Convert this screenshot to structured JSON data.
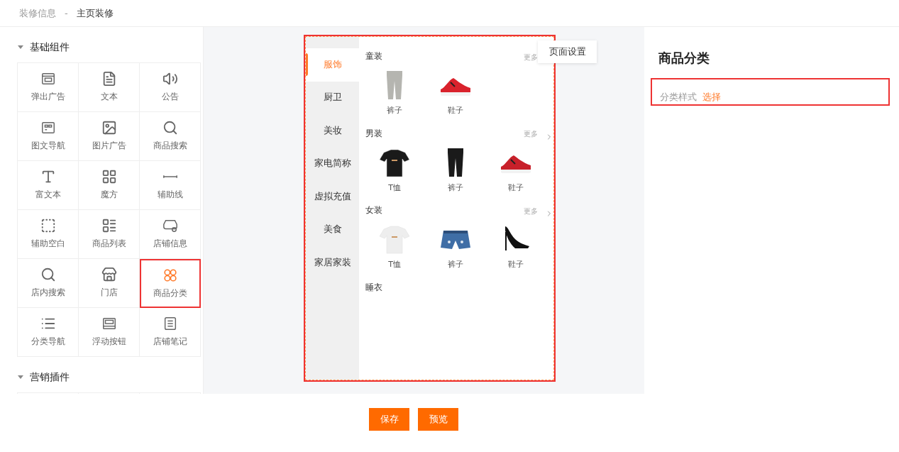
{
  "breadcrumb": {
    "parent": "装修信息",
    "separator": "-",
    "current": "主页装修"
  },
  "component_groups": [
    {
      "title": "基础组件",
      "expanded": true,
      "items": [
        {
          "label": "弹出广告",
          "selected": false
        },
        {
          "label": "文本",
          "selected": false
        },
        {
          "label": "公告",
          "selected": false
        },
        {
          "label": "图文导航",
          "selected": false
        },
        {
          "label": "图片广告",
          "selected": false
        },
        {
          "label": "商品搜索",
          "selected": false
        },
        {
          "label": "富文本",
          "selected": false
        },
        {
          "label": "魔方",
          "selected": false
        },
        {
          "label": "辅助线",
          "selected": false
        },
        {
          "label": "辅助空白",
          "selected": false
        },
        {
          "label": "商品列表",
          "selected": false
        },
        {
          "label": "店铺信息",
          "selected": false
        },
        {
          "label": "店内搜索",
          "selected": false
        },
        {
          "label": "门店",
          "selected": false
        },
        {
          "label": "商品分类",
          "selected": true
        },
        {
          "label": "分类导航",
          "selected": false
        },
        {
          "label": "浮动按钮",
          "selected": false
        },
        {
          "label": "店铺笔记",
          "selected": false
        }
      ]
    },
    {
      "title": "营销插件",
      "expanded": true
    }
  ],
  "preview": {
    "tab": "页面设置",
    "categories": [
      {
        "label": "服饰",
        "selected": true
      },
      {
        "label": "厨卫",
        "selected": false
      },
      {
        "label": "美妆",
        "selected": false
      },
      {
        "label": "家电简称",
        "selected": false
      },
      {
        "label": "虚拟充值",
        "selected": false
      },
      {
        "label": "美食",
        "selected": false
      },
      {
        "label": "家居家装",
        "selected": false
      }
    ],
    "sections": [
      {
        "title": "童装",
        "more": "更多",
        "products": [
          {
            "name": "裤子"
          },
          {
            "name": "鞋子"
          }
        ]
      },
      {
        "title": "男装",
        "more": "更多",
        "more_arrow": true,
        "products": [
          {
            "name": "T恤"
          },
          {
            "name": "裤子"
          },
          {
            "name": "鞋子"
          }
        ]
      },
      {
        "title": "女装",
        "more": "更多",
        "more_arrow": true,
        "products": [
          {
            "name": "T恤"
          },
          {
            "name": "裤子"
          },
          {
            "name": "鞋子"
          }
        ]
      },
      {
        "title": "睡衣"
      }
    ]
  },
  "settings": {
    "title": "商品分类",
    "fields": [
      {
        "label": "分类样式",
        "value": "选择"
      }
    ]
  },
  "buttons": [
    "保存",
    "预览"
  ]
}
